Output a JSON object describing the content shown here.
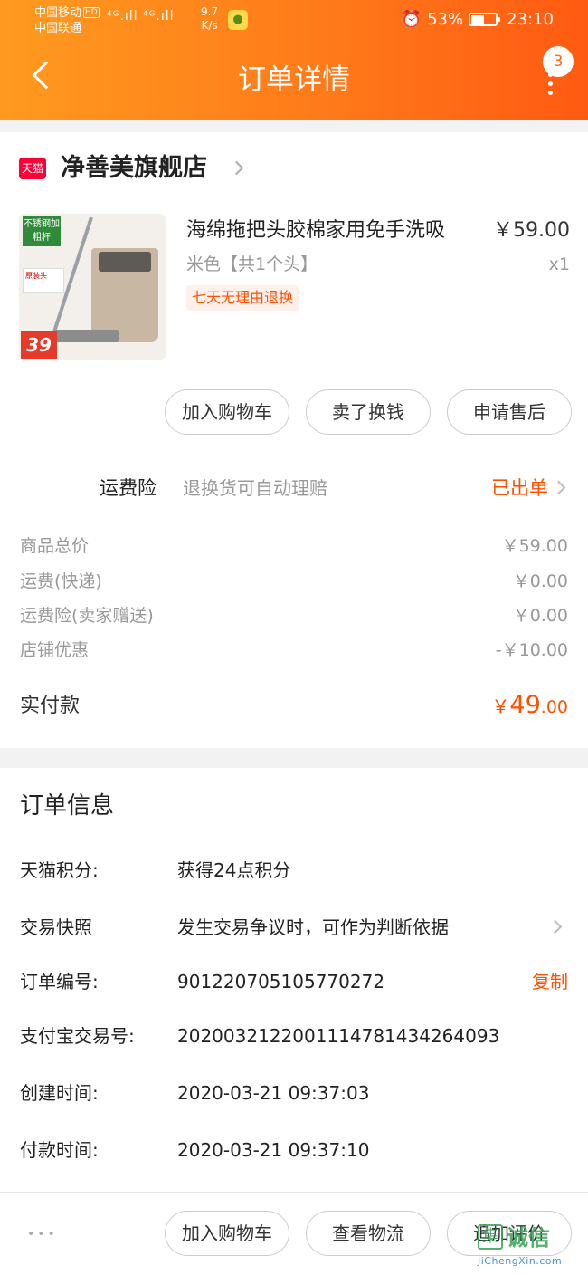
{
  "status_bar": {
    "carrier1": "中国移动",
    "carrier1_hd": "HD",
    "carrier2": "中国联通",
    "signal": "⁴ᴳ.ıll ⁴ᴳ.ıll",
    "speed_value": "9.7",
    "speed_unit": "K/s",
    "battery_percent": "53%",
    "battery_level": 0.53,
    "time": "23:10"
  },
  "nav": {
    "title": "订单详情",
    "badge_count": "3"
  },
  "store": {
    "logo_text": "天猫",
    "name": "净善美旗舰店"
  },
  "product": {
    "image_badge": "不锈钢加粗杆",
    "image_price": "39",
    "image_label": "原装头",
    "title": "海绵拖把头胶棉家用免手洗吸",
    "sku": "米色【共1个头】",
    "tag": "七天无理由退换",
    "price": "￥59.00",
    "quantity": "x1"
  },
  "item_actions": {
    "add_cart": "加入购物车",
    "resell": "卖了换钱",
    "after_sale": "申请售后"
  },
  "insurance": {
    "label": "运费险",
    "description": "退换货可自动理赔",
    "status": "已出单"
  },
  "fees": [
    {
      "label": "商品总价",
      "value": "￥59.00"
    },
    {
      "label": "运费(快递)",
      "value": "￥0.00"
    },
    {
      "label": "运费险(卖家赠送)",
      "value": "￥0.00"
    },
    {
      "label": "店铺优惠",
      "value": "-￥10.00"
    }
  ],
  "paid": {
    "label": "实付款",
    "currency": "￥",
    "integer": "49",
    "decimal": ".00"
  },
  "order_info": {
    "title": "订单信息",
    "points_label": "天猫积分:",
    "points_value": "获得24点积分",
    "snapshot_label": "交易快照",
    "snapshot_value": "发生交易争议时，可作为判断依据",
    "order_no_label": "订单编号:",
    "order_no_value": "901220705105770272",
    "copy": "复制",
    "alipay_label": "支付宝交易号:",
    "alipay_value": "2020032122001114781434264093",
    "created_label": "创建时间:",
    "created_value": "2020-03-21 09:37:03",
    "paid_label": "付款时间:",
    "paid_value": "2020-03-21 09:37:10"
  },
  "bottom_bar": {
    "more": "•••",
    "add_cart": "加入购物车",
    "logistics": "查看物流",
    "review": "追加评价"
  },
  "watermark": {
    "mark": "集",
    "text": "诚信",
    "url": "JiChengXin.com"
  },
  "colors": {
    "accent": "#ff5000",
    "header_start": "#ff9a1f",
    "header_end": "#ff5a12",
    "tmall_red": "#ff0036"
  }
}
